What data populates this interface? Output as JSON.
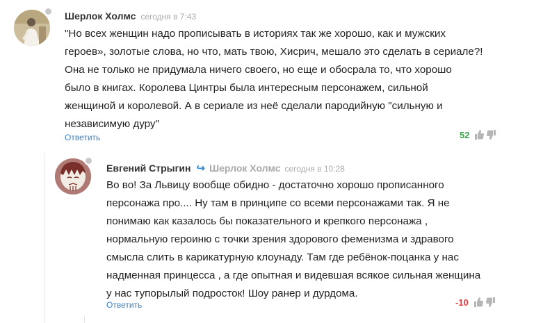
{
  "comments": [
    {
      "author": "Шерлок Холмс",
      "time": "сегодня в 7:43",
      "lines": [
        "\"Но всех женщин надо прописывать в историях так же хорошо, как и мужских",
        "героев», золотые слова, но что, мать твою, Хисрич, мешало это сделать в сериале?!",
        "Она не только не придумала ничего своего, но еще и обосрала то, что хорошо",
        "было в книгах. Королева Цинтры была интересным персонажем, сильной",
        "женщиной и королевой. А в сериале из неё сделали пародийную \"сильную и",
        "независимую дуру\""
      ],
      "reply_label": "Ответить",
      "score": "52",
      "avatar_colors": {
        "bg": "#cdbf9d",
        "figure": "#ffffff"
      }
    },
    {
      "author": "Евгений Стрыгин",
      "reply_to": "Шерлок Холмс",
      "reply_arrow": "↪",
      "time": "сегодня в 10:28",
      "lines": [
        "Во во! За Львицу вообще обидно - достаточно хорошо прописанного",
        "персонажа про.... Ну там в принципе со всеми персонажами так. Я не",
        "понимаю как казалось бы показательного и крепкого персонажа ,",
        "нормальную героиню с точки зрения здорового феменизма и здравого",
        "смысла слить в карикатурную клоунаду. Там где ребёнок-поцанка у нас",
        "надменная принцесса , а где опытная и видевшая всякое сильная женщина",
        "у нас тупорылый подросток! Шоу ранер и дурдома."
      ],
      "reply_label": "Ответить",
      "score": "-10",
      "avatar_colors": {
        "bg": "#b07a74",
        "face": "#f1ece4",
        "hair": "#7a2f2a"
      }
    }
  ],
  "colors": {
    "accent": "#3b7fc4",
    "positive": "#3aa34a",
    "negative": "#e2383a",
    "muted": "#aaaaaa"
  },
  "icons": [
    "thumbs-up-icon",
    "thumbs-down-icon",
    "reply-arrow-icon"
  ]
}
